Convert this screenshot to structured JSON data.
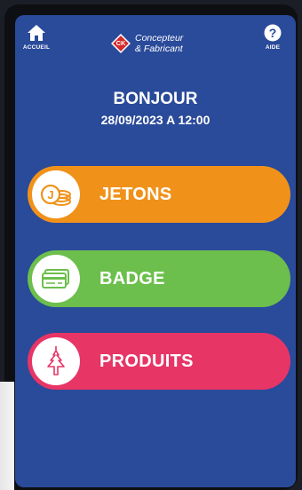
{
  "nav": {
    "home_label": "ACCUEIL",
    "help_label": "AIDE"
  },
  "brand": {
    "badge_text": "CK",
    "line1": "Concepteur",
    "line2": "& Fabricant",
    "badge_color": "#d62b2b"
  },
  "welcome": {
    "greeting": "BONJOUR",
    "datetime": "28/09/2023 A 12:00"
  },
  "menu": [
    {
      "label": "JETONS",
      "icon": "tokens-icon",
      "color": "#f0921a"
    },
    {
      "label": "BADGE",
      "icon": "card-icon",
      "color": "#6cbf4c"
    },
    {
      "label": "PRODUITS",
      "icon": "air-freshener-icon",
      "color": "#e73566"
    }
  ],
  "colors": {
    "screen_bg": "#2a4a9a",
    "text": "#ffffff"
  }
}
